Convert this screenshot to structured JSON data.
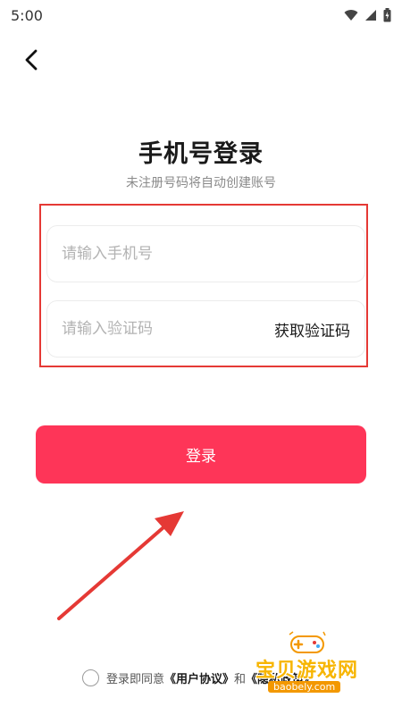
{
  "status_bar": {
    "time": "5:00",
    "icons": [
      "wifi-icon",
      "signal-icon",
      "battery-icon"
    ]
  },
  "header": {
    "back_icon": "chevron-left-icon"
  },
  "login": {
    "title": "手机号登录",
    "subtitle": "未注册号码将自动创建账号",
    "phone_placeholder": "请输入手机号",
    "code_placeholder": "请输入验证码",
    "get_code_label": "获取验证码",
    "submit_label": "登录"
  },
  "agreement": {
    "prefix": "登录即同意",
    "user_agreement": "《用户协议》",
    "and": "和",
    "privacy_policy": "《隐私政策》"
  },
  "watermark": {
    "name": "宝贝游戏网",
    "url": "baobely.com"
  },
  "colors": {
    "accent": "#fe3558",
    "highlight_border": "#e53935",
    "arrow": "#e53935",
    "watermark": "#f7b500"
  }
}
